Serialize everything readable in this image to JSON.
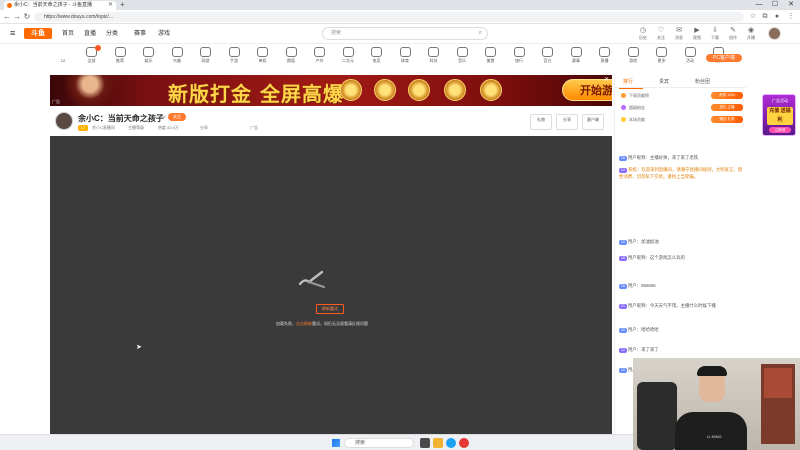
{
  "browser": {
    "tab_title": "余小C：当前天命之孩子 - 斗鱼直播",
    "url": "https://www.douyu.com/topic/...",
    "new_tab": "+",
    "win_minimize": "—",
    "win_maximize": "☐",
    "win_close": "✕"
  },
  "site": {
    "logo": "斗鱼",
    "nav": [
      "首页",
      "直播",
      "分类",
      "赛事",
      "游戏"
    ],
    "search_placeholder": "搜索",
    "header_icons": [
      "历史",
      "关注",
      "消息",
      "视频",
      "下载",
      "创作",
      "开播"
    ]
  },
  "categories": [
    {
      "label": "12"
    },
    {
      "label": "全部"
    },
    {
      "label": "推荐"
    },
    {
      "label": "娱乐"
    },
    {
      "label": "鸟巢"
    },
    {
      "label": "网游"
    },
    {
      "label": "手游"
    },
    {
      "label": "单机"
    },
    {
      "label": "颜值"
    },
    {
      "label": "户外"
    },
    {
      "label": "二次元"
    },
    {
      "label": "电竞"
    },
    {
      "label": "体育"
    },
    {
      "label": "科技"
    },
    {
      "label": "音乐"
    },
    {
      "label": "美食"
    },
    {
      "label": "旅行"
    },
    {
      "label": "官方"
    },
    {
      "label": "赛事"
    },
    {
      "label": "直播"
    },
    {
      "label": "游戏"
    },
    {
      "label": "更多"
    },
    {
      "label": "活动"
    },
    {
      "label": "任务"
    }
  ],
  "pc_button": "PC客户端",
  "banner": {
    "headline": "新版打金 全屏高爆",
    "cta": "开始游戏",
    "close": "✕",
    "ad_label": "广告"
  },
  "streamer": {
    "title": "余小C：当前天命之孩子",
    "room_id": "3123456",
    "follow_label": "关注",
    "level": "17",
    "info": [
      "余小C直播间",
      "主播等级",
      "热度 83.9万",
      "分享",
      "广告"
    ],
    "buttons": [
      "礼物",
      "分享",
      "客户端"
    ]
  },
  "player": {
    "error_button": "刷新重试",
    "error_text_prefix": "加载失败，",
    "error_text_highlight": "点击刷新",
    "error_text_suffix": "重试，如仍无法观看请反馈问题"
  },
  "rpanel": {
    "tabs": [
      "排行",
      "贵宾",
      "粉丝团"
    ],
    "rank_rows": [
      {
        "label": "下周贡献榜",
        "pill": "贵宾 1234"
      },
      {
        "label": "超级粉丝",
        "pill": "送礼 主播"
      },
      {
        "label": "本场贡献",
        "pill": "赠送 礼物"
      }
    ],
    "messages": [
      {
        "tag": "10",
        "text": "用户昵称：主播好帅，来了来了老铁"
      },
      {
        "tag": "LV",
        "text": "系统：欢迎来到直播间，请遵守直播间规则，文明发言，理性消费，切勿私下交易，谨防上当受骗。"
      },
      {
        "tag": "10",
        "text": "用户：加油加油"
      },
      {
        "tag": "18",
        "text": "用户昵称：这个游戏怎么玩的"
      },
      {
        "tag": "10",
        "text": "用户：666666"
      },
      {
        "tag": "21",
        "text": "用户昵称：今天天气不错，主播什么时候下播"
      },
      {
        "tag": "20",
        "text": "用户：哈哈哈哈"
      },
      {
        "tag": "12",
        "text": "用户：来了来了"
      },
      {
        "tag": "10",
        "text": "用户昵称：支持主播"
      }
    ]
  },
  "sidead": {
    "title": "广告活动",
    "body": "充值 送福利",
    "button": "立即领"
  },
  "webcam": {
    "brand": "LI-NING"
  },
  "taskbar": {
    "search": "搜索"
  }
}
